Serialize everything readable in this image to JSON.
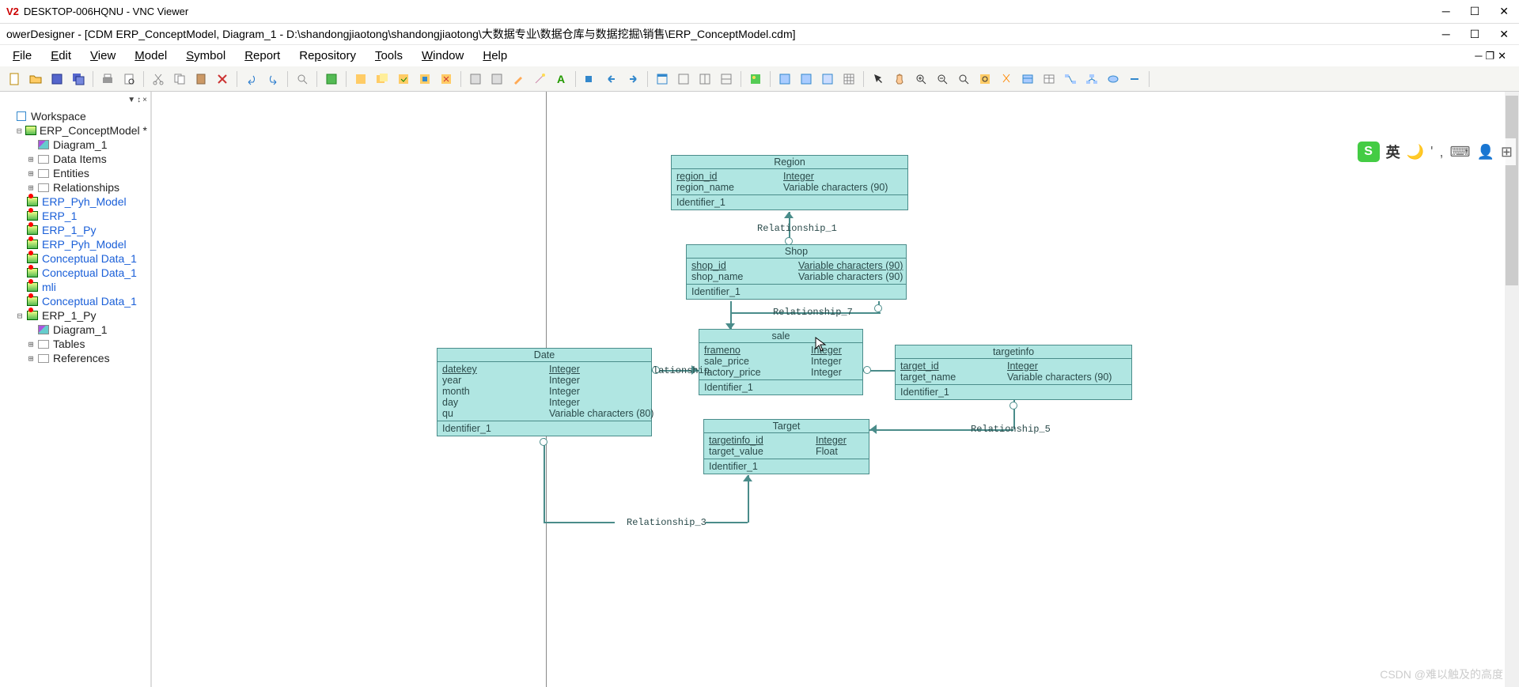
{
  "vnc": {
    "title": "DESKTOP-006HQNU - VNC Viewer"
  },
  "pd": {
    "title": "owerDesigner - [CDM ERP_ConceptModel, Diagram_1 - D:\\shandongjiaotong\\shandongjiaotong\\大数据专业\\数据仓库与数据挖掘\\销售\\ERP_ConceptModel.cdm]"
  },
  "menu": [
    "File",
    "Edit",
    "View",
    "Model",
    "Symbol",
    "Report",
    "Repository",
    "Tools",
    "Window",
    "Help"
  ],
  "tree": [
    {
      "d": 0,
      "exp": "",
      "label": "Workspace",
      "type": "ws",
      "link": false
    },
    {
      "d": 1,
      "exp": "-",
      "label": "ERP_ConceptModel *",
      "type": "model",
      "link": false
    },
    {
      "d": 2,
      "exp": "",
      "label": "Diagram_1",
      "type": "diag",
      "link": false
    },
    {
      "d": 2,
      "exp": "+",
      "label": "Data Items",
      "type": "folder",
      "link": false
    },
    {
      "d": 2,
      "exp": "+",
      "label": "Entities",
      "type": "folder",
      "link": false
    },
    {
      "d": 2,
      "exp": "+",
      "label": "Relationships",
      "type": "folder",
      "link": false
    },
    {
      "d": 1,
      "exp": "",
      "label": "ERP_Pyh_Model",
      "type": "model",
      "link": true,
      "mark": true
    },
    {
      "d": 1,
      "exp": "",
      "label": "ERP_1",
      "type": "model",
      "link": true,
      "mark": true
    },
    {
      "d": 1,
      "exp": "",
      "label": "ERP_1_Py",
      "type": "model",
      "link": true,
      "mark": true
    },
    {
      "d": 1,
      "exp": "",
      "label": "ERP_Pyh_Model",
      "type": "model",
      "link": true,
      "mark": true
    },
    {
      "d": 1,
      "exp": "",
      "label": "Conceptual Data_1",
      "type": "model",
      "link": true,
      "mark": true
    },
    {
      "d": 1,
      "exp": "",
      "label": "Conceptual Data_1",
      "type": "model",
      "link": true,
      "mark": true
    },
    {
      "d": 1,
      "exp": "",
      "label": "mli",
      "type": "model",
      "link": true,
      "mark": true
    },
    {
      "d": 1,
      "exp": "",
      "label": "Conceptual Data_1",
      "type": "model",
      "link": true,
      "mark": true
    },
    {
      "d": 1,
      "exp": "-",
      "label": "ERP_1_Py",
      "type": "model",
      "link": false,
      "mark": true
    },
    {
      "d": 2,
      "exp": "",
      "label": "Diagram_1",
      "type": "diag",
      "link": false
    },
    {
      "d": 2,
      "exp": "+",
      "label": "Tables",
      "type": "folder",
      "link": false
    },
    {
      "d": 2,
      "exp": "+",
      "label": "References",
      "type": "folder",
      "link": false
    }
  ],
  "entities": {
    "region": {
      "title": "Region",
      "attrs": [
        {
          "name": "region_id",
          "pi": "<pi>",
          "type": "Integer",
          "m": "<M>",
          "u": true
        },
        {
          "name": "region_name",
          "pi": "",
          "type": "Variable characters (90)",
          "m": ""
        }
      ],
      "ident": "Identifier_1  <pi>"
    },
    "shop": {
      "title": "Shop",
      "attrs": [
        {
          "name": "shop_id",
          "pi": "<pi>",
          "type": "Variable characters (90)",
          "m": "<M>",
          "u": true
        },
        {
          "name": "shop_name",
          "pi": "",
          "type": "Variable characters (90)",
          "m": ""
        }
      ],
      "ident": "Identifier_1  <pi>"
    },
    "date": {
      "title": "Date",
      "attrs": [
        {
          "name": "datekey",
          "pi": "<pi>",
          "type": "Integer",
          "m": "<M>",
          "u": true
        },
        {
          "name": "year",
          "pi": "",
          "type": "Integer",
          "m": ""
        },
        {
          "name": "month",
          "pi": "",
          "type": "Integer",
          "m": ""
        },
        {
          "name": "day",
          "pi": "",
          "type": "Integer",
          "m": ""
        },
        {
          "name": "qu",
          "pi": "",
          "type": "Variable characters (80)",
          "m": ""
        }
      ],
      "ident": "Identifier_1  <pi>"
    },
    "sale": {
      "title": "sale",
      "attrs": [
        {
          "name": "frameno",
          "pi": "<pi>",
          "type": "Integer",
          "m": "<M>",
          "u": true
        },
        {
          "name": "sale_price",
          "pi": "",
          "type": "Integer",
          "m": ""
        },
        {
          "name": "factory_price",
          "pi": "",
          "type": "Integer",
          "m": ""
        }
      ],
      "ident": "Identifier_1  <pi>"
    },
    "target": {
      "title": "Target",
      "attrs": [
        {
          "name": "targetinfo_id",
          "pi": "<pi>",
          "type": "Integer",
          "m": "<M>",
          "u": true
        },
        {
          "name": "target_value",
          "pi": "",
          "type": "Float",
          "m": ""
        }
      ],
      "ident": "Identifier_1  <pi>"
    },
    "targetinfo": {
      "title": "targetinfo",
      "attrs": [
        {
          "name": "target_id",
          "pi": "<pi>",
          "type": "Integer",
          "m": "<M>",
          "u": true
        },
        {
          "name": "target_name",
          "pi": "",
          "type": "Variable characters (90)",
          "m": ""
        }
      ],
      "ident": "Identifier_1  <pi>"
    }
  },
  "relationships": {
    "r1": "Relationship_1",
    "r3": "Relationship_3",
    "r5": "Relationship_5",
    "r7": "Relationship_7",
    "rl": "lationship"
  },
  "floatbar": {
    "lang": "英"
  },
  "watermark": "CSDN @难以触及的高度"
}
